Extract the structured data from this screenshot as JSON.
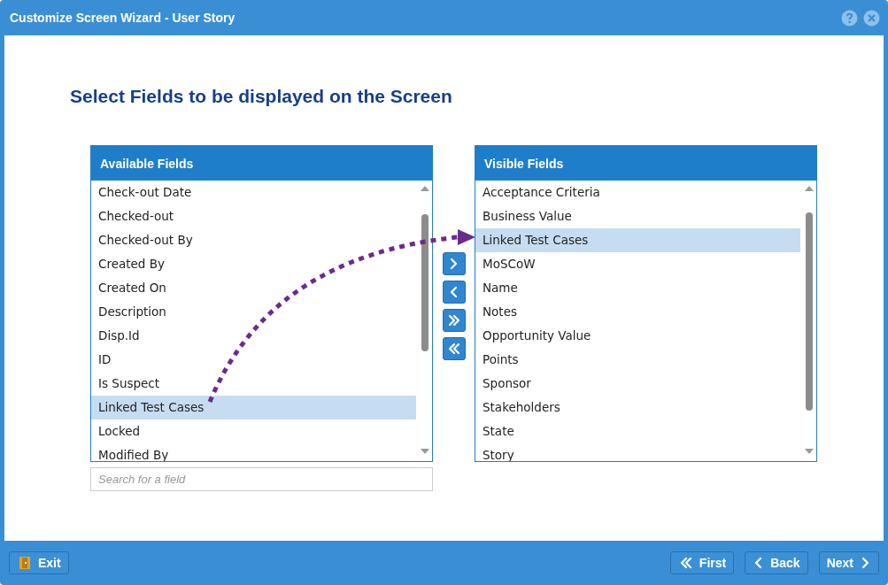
{
  "window": {
    "title": "Customize Screen Wizard - User Story"
  },
  "heading": "Select Fields to be displayed on the Screen",
  "available": {
    "title": "Available Fields",
    "items": [
      {
        "label": "Check-out Date",
        "selected": false
      },
      {
        "label": "Checked-out",
        "selected": false
      },
      {
        "label": "Checked-out By",
        "selected": false
      },
      {
        "label": "Created By",
        "selected": false
      },
      {
        "label": "Created On",
        "selected": false
      },
      {
        "label": "Description",
        "selected": false
      },
      {
        "label": "Disp.Id",
        "selected": false
      },
      {
        "label": "ID",
        "selected": false
      },
      {
        "label": "Is Suspect",
        "selected": false
      },
      {
        "label": "Linked Test Cases",
        "selected": true
      },
      {
        "label": "Locked",
        "selected": false
      },
      {
        "label": "Modified By",
        "selected": false
      }
    ],
    "search": {
      "placeholder": "Search for a field"
    }
  },
  "visible": {
    "title": "Visible Fields",
    "items": [
      {
        "label": "Acceptance Criteria",
        "selected": false
      },
      {
        "label": "Business Value",
        "selected": false
      },
      {
        "label": "Linked Test Cases",
        "selected": true
      },
      {
        "label": "MoSCoW",
        "selected": false
      },
      {
        "label": "Name",
        "selected": false
      },
      {
        "label": "Notes",
        "selected": false
      },
      {
        "label": "Opportunity Value",
        "selected": false
      },
      {
        "label": "Points",
        "selected": false
      },
      {
        "label": "Sponsor",
        "selected": false
      },
      {
        "label": "Stakeholders",
        "selected": false
      },
      {
        "label": "State",
        "selected": false
      },
      {
        "label": "Story",
        "selected": false
      }
    ]
  },
  "footer": {
    "left": [
      {
        "label": "Exit",
        "kind": "exit"
      }
    ],
    "right": [
      {
        "label": "First",
        "kind": "first"
      },
      {
        "label": "Back",
        "kind": "back"
      },
      {
        "label": "Next",
        "kind": "next"
      }
    ]
  }
}
